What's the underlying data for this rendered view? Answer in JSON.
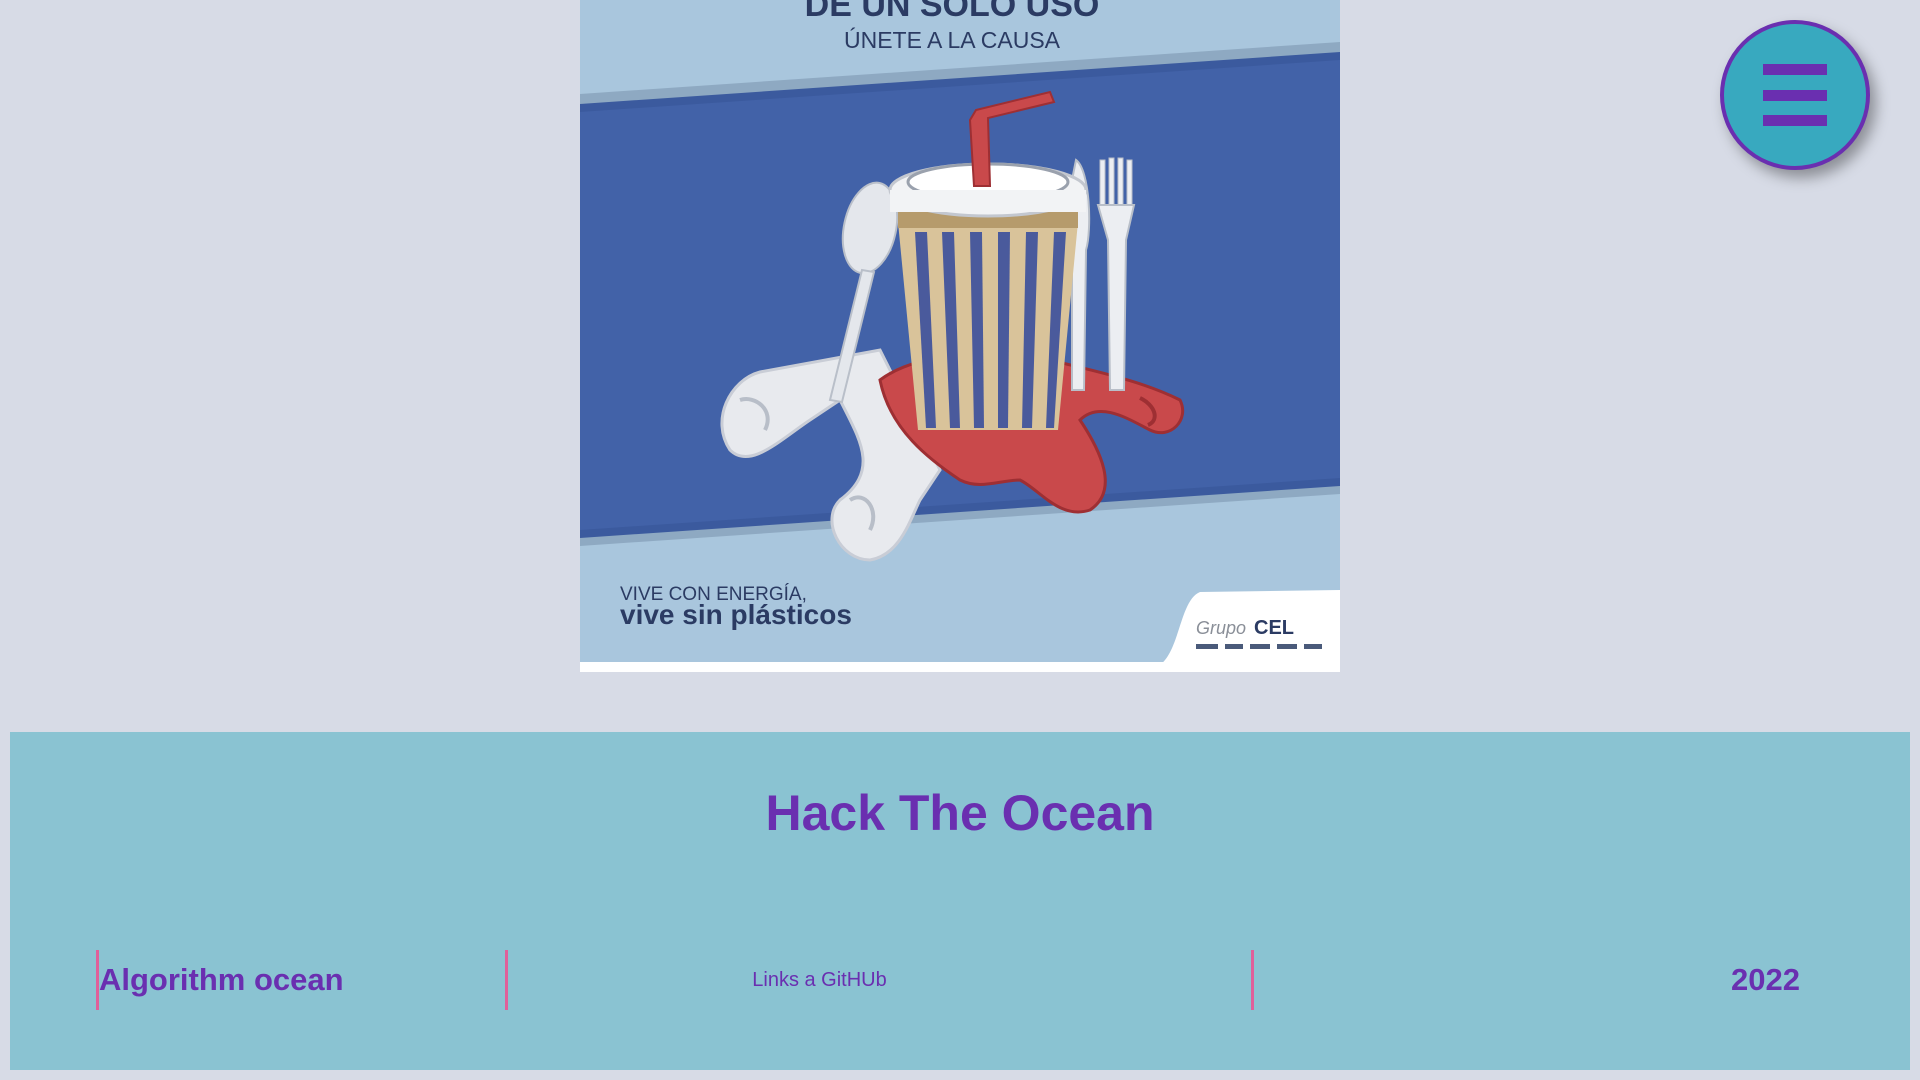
{
  "poster": {
    "headline": "DE UN SOLO USO",
    "subheadline": "ÚNETE A LA CAUSA",
    "tagline_small": "VIVE CON ENERGÍA,",
    "tagline_large": "vive sin plásticos",
    "logo_grupo": "Grupo",
    "logo_cel": "CEL",
    "colors": {
      "light_blue": "#a9c6dd",
      "band_blue": "#4262a8",
      "dark_text": "#2b3b63",
      "straw_red": "#c9494b"
    }
  },
  "menu": {
    "icon": "hamburger-icon",
    "color": "#6a2fb0",
    "background": "#38a9bf"
  },
  "footer": {
    "title": "Hack The Ocean",
    "team": "Algorithm ocean",
    "link_label": "Links a GitHUb",
    "year": "2022",
    "colors": {
      "background": "#8ac3d2",
      "text": "#6a2fb0",
      "divider": "#e0609a"
    }
  }
}
